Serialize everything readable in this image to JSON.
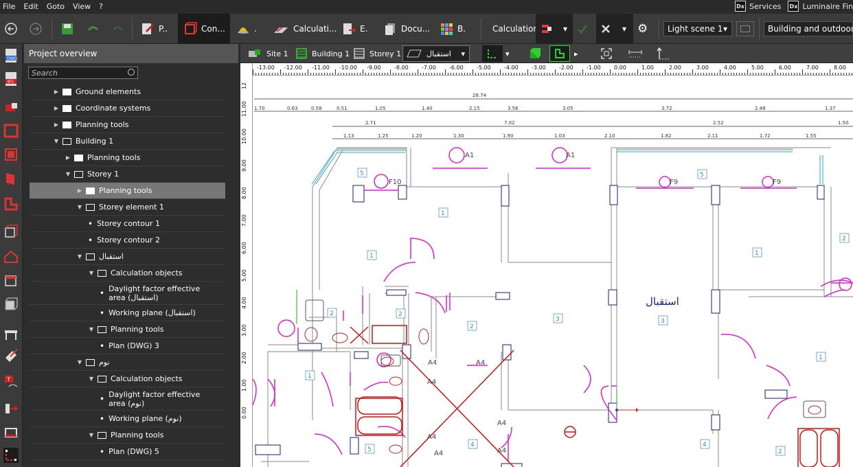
{
  "menu": [
    "File",
    "Edit",
    "Goto",
    "View",
    "?"
  ],
  "menu_right": {
    "services": "Services",
    "luminaire": "Luminaire Fin",
    "dx": "Dx"
  },
  "toolbar": {
    "tab_p": "P..",
    "tab_con": "Con...",
    "tab_dot": ".",
    "tab_calc": "Calculati...",
    "tab_e": "E.",
    "tab_docu": "Docu...",
    "tab_b": "B.",
    "calculation": "Calculation",
    "light_scene": "Light scene 1",
    "building_outdoor": "Building and outdoor pla..."
  },
  "panel": {
    "title": "Project overview",
    "search_placeholder": "Search"
  },
  "tree": [
    {
      "label": "Ground elements",
      "indent": 0,
      "type": "folder",
      "arrow": "right"
    },
    {
      "label": "Coordinate systems",
      "indent": 0,
      "type": "folder",
      "arrow": "right"
    },
    {
      "label": "Planning tools",
      "indent": 0,
      "type": "folder",
      "arrow": "right"
    },
    {
      "label": "Building 1",
      "indent": 0,
      "type": "folder-open",
      "arrow": "down"
    },
    {
      "label": "Planning tools",
      "indent": 1,
      "type": "folder",
      "arrow": "right"
    },
    {
      "label": "Storey 1",
      "indent": 1,
      "type": "folder-open",
      "arrow": "down"
    },
    {
      "label": "Planning tools",
      "indent": 2,
      "type": "folder",
      "arrow": "right",
      "selected": true
    },
    {
      "label": "Storey element 1",
      "indent": 2,
      "type": "folder-open",
      "arrow": "down"
    },
    {
      "label": "Storey contour 1",
      "indent": 3,
      "type": "item"
    },
    {
      "label": "Storey contour 2",
      "indent": 3,
      "type": "item"
    },
    {
      "label": "استقبال",
      "indent": 2,
      "type": "folder-open",
      "arrow": "down"
    },
    {
      "label": "Calculation objects",
      "indent": 3,
      "type": "folder-open",
      "arrow": "down"
    },
    {
      "label": "Daylight factor effective area (استقبال)",
      "indent": 4,
      "type": "item",
      "tall": true
    },
    {
      "label": "Working plane (استقبال)",
      "indent": 4,
      "type": "item"
    },
    {
      "label": "Planning tools",
      "indent": 3,
      "type": "folder-open",
      "arrow": "down"
    },
    {
      "label": "Plan (DWG) 3",
      "indent": 4,
      "type": "item"
    },
    {
      "label": "نوم",
      "indent": 2,
      "type": "folder-open",
      "arrow": "down"
    },
    {
      "label": "Calculation objects",
      "indent": 3,
      "type": "folder-open",
      "arrow": "down"
    },
    {
      "label": "Daylight factor effective area (نوم)",
      "indent": 4,
      "type": "item",
      "tall": true
    },
    {
      "label": "Working plane (نوم)",
      "indent": 4,
      "type": "item"
    },
    {
      "label": "Planning tools",
      "indent": 3,
      "type": "folder-open",
      "arrow": "down"
    },
    {
      "label": "Plan (DWG) 5",
      "indent": 4,
      "type": "item"
    }
  ],
  "viewtb": {
    "site": "Site 1",
    "building": "Building 1",
    "storey": "Storey 1",
    "room": "استقبال"
  },
  "cad": {
    "ruler_top": [
      "-13.00",
      "-12.00",
      "-11.00",
      "-10.00",
      "-9.00",
      "-8.00",
      "-7.00",
      "-6.00",
      "-5.00",
      "-4.00",
      "-3.00",
      "-2.00",
      "-1.00",
      "0.00",
      "1.00",
      "2.00",
      "3.00",
      "4.00",
      "5.00",
      "6.00",
      "7.00",
      "8.00"
    ],
    "ruler_left": [
      "12",
      "11.00",
      "10.00",
      "9.00",
      "8.00",
      "7.00",
      "6.00",
      "5.00",
      "4.00",
      "3.00",
      "2.00",
      "1.00",
      "0.00"
    ],
    "room_label": "استقبال",
    "dims_row1": [
      "28.74"
    ],
    "dims_row2": [
      "1.70",
      "0.63",
      "0.58",
      "0.51",
      "1.05",
      "1.40",
      "2.15",
      "3.56",
      "3.05",
      "3.72",
      "2.48",
      "1.37"
    ],
    "dims_row3": [
      "2.71",
      "7.02",
      "2.52",
      "1.50"
    ],
    "dims_row4": [
      "1.13",
      "1.25",
      "1.20",
      "1.30",
      "1.90",
      "1.03",
      "2.10",
      "1.82",
      "2.11",
      "1.72",
      "1.55"
    ],
    "numbers": [
      "1",
      "1",
      "1",
      "1",
      "1",
      "2",
      "2",
      "2",
      "3",
      "3",
      "4",
      "4",
      "5",
      "5",
      "2",
      "2",
      "5"
    ],
    "tags": [
      "A1",
      "A1",
      "F10",
      "F9",
      "F9",
      "A4",
      "A4",
      "A4",
      "A4",
      "A4",
      "A4",
      "A4"
    ]
  }
}
